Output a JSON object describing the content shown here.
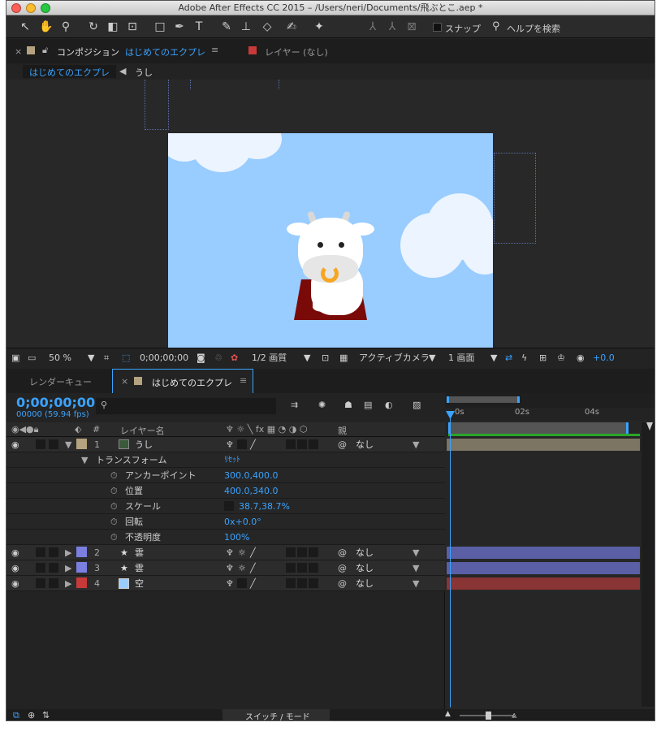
{
  "window": {
    "title": "Adobe After Effects CC 2015 – /Users/neri/Documents/飛ぶとこ.aep *"
  },
  "toolbar": {
    "snap_label": "スナップ",
    "help_search": "ヘルプを検索",
    "tools": [
      "selection-arrow-icon",
      "hand-icon",
      "zoom-icon",
      "rotate-icon",
      "camera-icon",
      "pan-behind-icon",
      "rectangle-icon",
      "pen-icon",
      "text-icon",
      "brush-icon",
      "clone-stamp-icon",
      "eraser-icon",
      "roto-brush-icon",
      "puppet-pin-icon"
    ]
  },
  "comp_panel": {
    "tab_comp_prefix": "コンポジション",
    "tab_comp_name": "はじめてのエクプレ",
    "tab_layer": "レイヤー (なし)",
    "breadcrumb_active": "はじめてのエクプレ",
    "breadcrumb_child": "うし"
  },
  "viewer_bar": {
    "zoom": "50 %",
    "timecode": "0;00;00;00",
    "resolution": "1/2 画質",
    "camera": "アクティブカメラ",
    "views": "1 画面",
    "exposure": "+0.0"
  },
  "timeline": {
    "tab_render": "レンダーキュー",
    "tab_comp": "はじめてのエクプレ",
    "timecode": "0;00;00;00",
    "frame_info": "00000 (59.94 fps)",
    "col_layer_name": "レイヤー名",
    "col_parent": "親",
    "col_num": "#",
    "ruler": [
      "0s",
      "02s",
      "04s"
    ],
    "status_toggle": "スイッチ / モード",
    "layers": [
      {
        "num": "1",
        "name": "うし",
        "parent": "なし",
        "color": "#b5a27f",
        "expanded": true
      },
      {
        "num": "2",
        "name": "雲",
        "parent": "なし",
        "color": "#7a7fe0",
        "expanded": false
      },
      {
        "num": "3",
        "name": "雲",
        "parent": "なし",
        "color": "#7a7fe0",
        "expanded": false
      },
      {
        "num": "4",
        "name": "空",
        "parent": "なし",
        "color": "#c83a3a",
        "expanded": false
      }
    ],
    "transform": {
      "group_label": "トランスフォーム",
      "reset_label": "ﾘｾｯﾄ",
      "props": [
        {
          "label": "アンカーポイント",
          "value": "300.0,400.0"
        },
        {
          "label": "位置",
          "value": "400.0,340.0"
        },
        {
          "label": "スケール",
          "value": "38.7,38.7%"
        },
        {
          "label": "回転",
          "value": "0x+0.0°"
        },
        {
          "label": "不透明度",
          "value": "100%"
        }
      ]
    }
  },
  "colors": {
    "accent": "#3aa3ff",
    "sky": "#99ccff",
    "panel": "#232323",
    "cloud_bar": "#5a5fa6",
    "sky_bar": "#8a3535",
    "cow_bar": "#7d7563"
  }
}
